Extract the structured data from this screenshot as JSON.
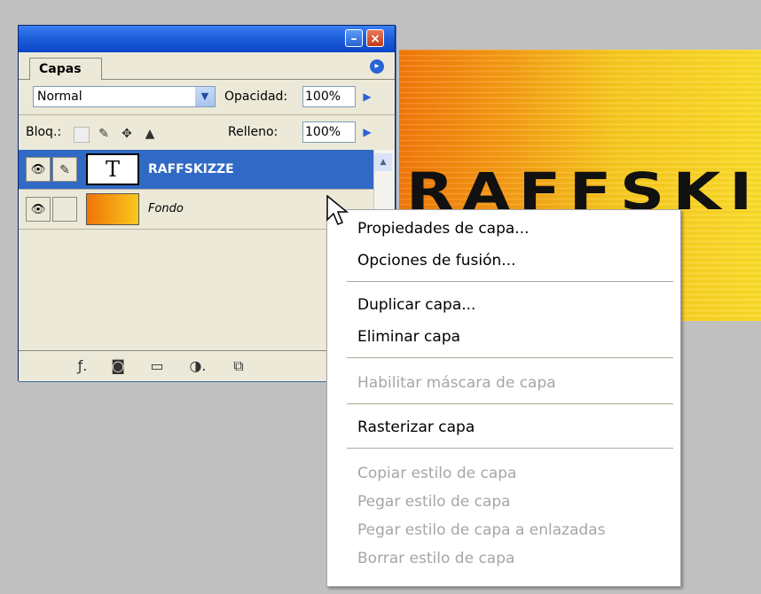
{
  "canvas": {
    "text": "RAFFSKIT"
  },
  "palette": {
    "tab_label": "Capas",
    "menu_arrow": "▸",
    "blend_mode": "Normal",
    "opacity_label": "Opacidad:",
    "opacity_value": "100%",
    "lock_label": "Bloq.:",
    "fill_label": "Relleno:",
    "fill_value": "100%",
    "layers": [
      {
        "name": "RAFFSKIZZE",
        "thumb": "T",
        "selected": true
      },
      {
        "name": "Fondo",
        "thumb": "",
        "selected": false
      }
    ]
  },
  "context_menu": {
    "items": [
      {
        "label": "Propiedades de capa...",
        "enabled": true
      },
      {
        "label": "Opciones de fusión...",
        "enabled": true
      },
      {
        "label": "Duplicar capa...",
        "enabled": true
      },
      {
        "label": "Eliminar capa",
        "enabled": true
      },
      {
        "label": "Habilitar máscara de capa",
        "enabled": false
      },
      {
        "label": "Rasterizar capa",
        "enabled": true
      },
      {
        "label": "Copiar estilo de capa",
        "enabled": false
      },
      {
        "label": "Pegar estilo de capa",
        "enabled": false
      },
      {
        "label": "Pegar estilo de capa a enlazadas",
        "enabled": false
      },
      {
        "label": "Borrar estilo de capa",
        "enabled": false
      }
    ]
  },
  "colors": {
    "title_blue": "#1f5fd8",
    "selection": "#316ac5",
    "disabled_text": "#a6a6a6"
  }
}
